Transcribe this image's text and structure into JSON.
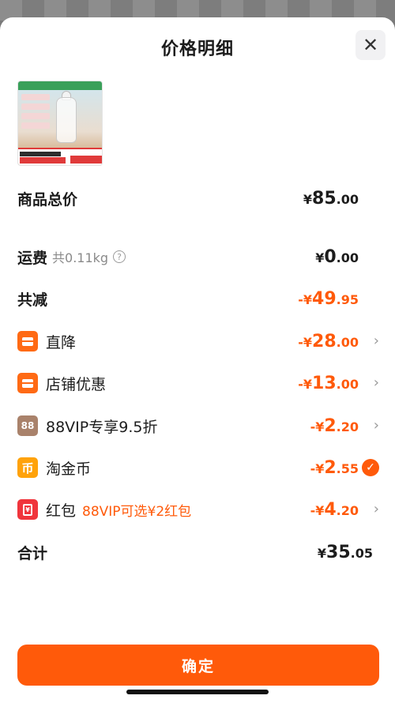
{
  "header": {
    "title": "价格明细"
  },
  "product": {
    "image_alt": "product-thumbnail"
  },
  "rows": [
    {
      "label": "商品总价",
      "currency": "¥",
      "int": "85",
      "dec": ".00"
    },
    {
      "label": "运费",
      "sub": "共0.11kg",
      "hint": "?",
      "currency": "¥",
      "int": "0",
      "dec": ".00"
    },
    {
      "label": "共减",
      "currency": "-¥",
      "int": "49",
      "dec": ".95"
    },
    {
      "label": "直降",
      "currency": "-¥",
      "int": "28",
      "dec": ".00"
    },
    {
      "label": "店铺优惠",
      "currency": "-¥",
      "int": "13",
      "dec": ".00"
    },
    {
      "label": "88VIP专享9.5折",
      "icon_text": "88",
      "currency": "-¥",
      "int": "2",
      "dec": ".20"
    },
    {
      "label": "淘金币",
      "icon_text": "币",
      "currency": "-¥",
      "int": "2",
      "dec": ".55"
    },
    {
      "label": "红包",
      "extra": "88VIP可选¥2红包",
      "currency": "-¥",
      "int": "4",
      "dec": ".20"
    },
    {
      "label": "合计",
      "currency": "¥",
      "int": "35",
      "dec": ".05"
    }
  ],
  "footer": {
    "confirm_label": "确定"
  },
  "icons": {
    "close": "close-icon",
    "chevron": "chevron-right-icon",
    "check": "check-icon"
  },
  "colors": {
    "accent": "#ff5a0a",
    "text": "#1c1c1c",
    "muted": "#8a8a8a"
  }
}
